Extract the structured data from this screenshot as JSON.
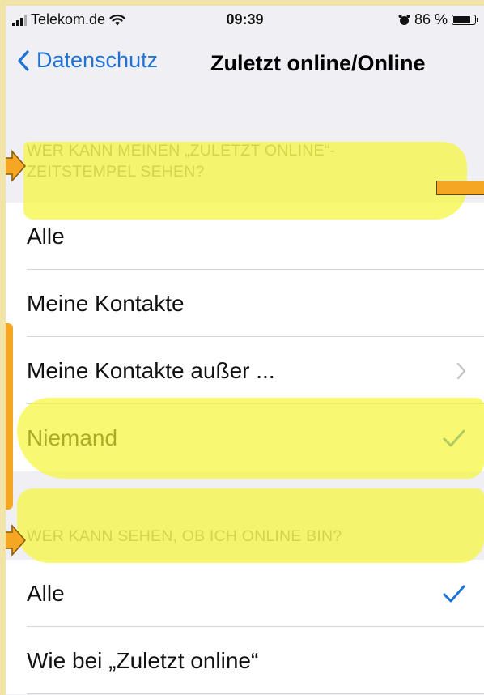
{
  "status_bar": {
    "carrier": "Telekom.de",
    "time": "09:39",
    "battery": "86 %",
    "battery_level": 0.86
  },
  "nav": {
    "back_label": "Datenschutz",
    "title": "Zuletzt online/Online"
  },
  "sections": [
    {
      "header_line1": "WER KANN MEINEN „ZULETZT ONLINE“-",
      "header_line2": "ZEITSTEMPEL SEHEN?",
      "options": [
        {
          "label": "Alle"
        },
        {
          "label": "Meine Kontakte"
        },
        {
          "label": "Meine Kontakte außer ..."
        },
        {
          "label": "Niemand"
        }
      ]
    },
    {
      "header": "WER KANN SEHEN, OB ICH ONLINE BIN?",
      "options": [
        {
          "label": "Alle"
        },
        {
          "label": "Wie bei „Zuletzt online“"
        }
      ]
    }
  ],
  "colors": {
    "accent": "#1f72d6",
    "checkmark_selected": "#1f72d6",
    "checkmark_highlighted": "#7ec28a",
    "highlight": "#f6f62d",
    "arrow": "#f5a623"
  }
}
